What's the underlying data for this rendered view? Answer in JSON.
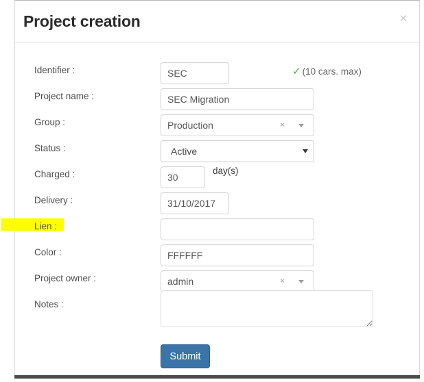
{
  "dialog": {
    "title": "Project creation",
    "close_label": "×"
  },
  "form": {
    "fields": [
      {
        "label": "Identifier :",
        "value": "SEC",
        "hint_check": "✓",
        "hint_text": "(10 cars. max)"
      },
      {
        "label": "Project name :",
        "value": "SEC Migration"
      },
      {
        "label": "Group :",
        "value": "Production",
        "clear_icon": "×"
      },
      {
        "label": "Status :",
        "value": "Active",
        "options": [
          "Active"
        ]
      },
      {
        "label": "Charged :",
        "value": "30",
        "suffix": "day(s)"
      },
      {
        "label": "Delivery :",
        "value": "31/10/2017"
      },
      {
        "label": "Lien :",
        "value": "",
        "highlighted": true,
        "highlight_color": "#ffff00"
      },
      {
        "label": "Color :",
        "value": "FFFFFF"
      },
      {
        "label": "Project owner :",
        "value": "admin",
        "clear_icon": "×"
      },
      {
        "label": "Notes :",
        "value": ""
      }
    ],
    "submit_label": "Submit"
  },
  "colors": {
    "submit_button": "#3b74a8",
    "highlight": "#ffff00",
    "check_green": "#4fa64f",
    "bottom_bar": "#4a4a4a"
  }
}
